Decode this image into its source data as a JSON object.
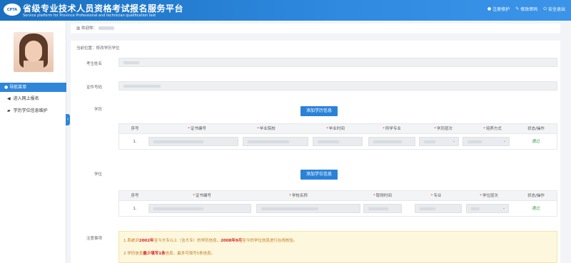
{
  "header": {
    "logo_text": "CPTA",
    "title_cn": "省级专业技术人员资格考试报名服务平台",
    "title_en": "Service platform for Province Professional and technician qualification test",
    "links": [
      {
        "icon": "info-circle-icon",
        "glyph": "●",
        "label": "注册修护"
      },
      {
        "icon": "edit-icon",
        "glyph": "✎",
        "label": "修改密码"
      },
      {
        "icon": "power-icon",
        "glyph": "⏻",
        "label": "安全退出"
      }
    ]
  },
  "sidebar": {
    "nav_head": "导航菜单",
    "items": [
      {
        "icon": "speaker-icon",
        "glyph": "◀",
        "label": "进入网上报名"
      },
      {
        "icon": "graduation-cap-icon",
        "glyph": "🎓",
        "label": "学历学位信息维护"
      }
    ],
    "collapse_glyph": "‹"
  },
  "welcome": {
    "icon": "bank-icon",
    "glyph": "🏛",
    "label": "欢迎你："
  },
  "main": {
    "breadcrumb": "当前位置：修改学历学位",
    "fields": {
      "name_label": "考生姓名",
      "id_label": "证件号码"
    },
    "education": {
      "section_label": "学历",
      "add_button": "添加学历信息",
      "columns": [
        {
          "label": "序号",
          "required": false
        },
        {
          "label": "证书编号",
          "required": true
        },
        {
          "label": "毕业院校",
          "required": true
        },
        {
          "label": "毕业时间",
          "required": true
        },
        {
          "label": "所学专业",
          "required": true
        },
        {
          "label": "学历层次",
          "required": true
        },
        {
          "label": "培养方式",
          "required": true
        },
        {
          "label": "状态/操作",
          "required": false
        }
      ],
      "rows": [
        {
          "index": "1.",
          "status": "通过"
        }
      ]
    },
    "degree": {
      "section_label": "学位",
      "add_button": "添加学位信息",
      "columns": [
        {
          "label": "序号",
          "required": false
        },
        {
          "label": "证书编号",
          "required": true
        },
        {
          "label": "学校名称",
          "required": true
        },
        {
          "label": "取得时间",
          "required": true
        },
        {
          "label": "专业",
          "required": true
        },
        {
          "label": "学位层次",
          "required": true
        },
        {
          "label": "状态/操作",
          "required": false
        }
      ],
      "rows": [
        {
          "index": "1.",
          "status": "通过"
        }
      ]
    },
    "notice": {
      "label": "注意事项",
      "line1_a": "1.系统对",
      "line1_hl1": "2002年",
      "line1_b": "至今大专以上（含大专）的学历信息，",
      "line1_hl2": "2008年9月",
      "line1_c": "至今的学位信息进行在线核验。",
      "line2_a": "2.学历信息",
      "line2_hl": "最少填写1条",
      "line2_b": "信息，最多可填写5条信息。"
    }
  },
  "colors": {
    "header_blue": "#2f8ae0",
    "button_blue": "#2a82d8",
    "status_green": "#3aa14a",
    "notice_bg": "#fdf7dd",
    "highlight_red": "#e02020"
  }
}
